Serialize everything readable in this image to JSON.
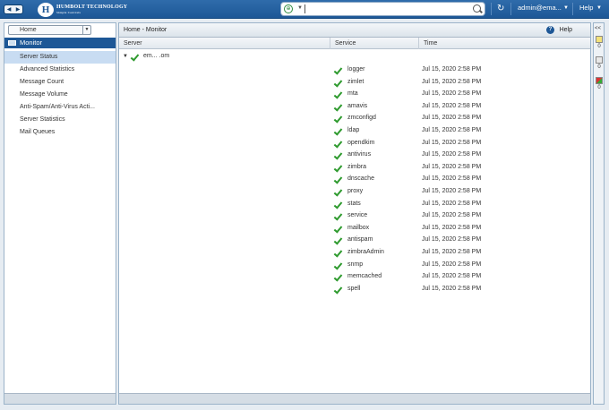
{
  "header": {
    "logo_text": "HUMBOLT TECHNOLOGY",
    "logo_subtext": "Simple Controls",
    "user": "admin@ema...",
    "help": "Help",
    "search": {
      "value": "",
      "placeholder": ""
    }
  },
  "left": {
    "home_select": "Home",
    "section": "Monitor",
    "items": [
      "Server Status",
      "Advanced Statistics",
      "Message Count",
      "Message Volume",
      "Anti-Spam/Anti-Virus Acti...",
      "Server Statistics",
      "Mail Queues"
    ],
    "selected_index": 0
  },
  "main": {
    "breadcrumb": "Home - Monitor",
    "help": "Help",
    "columns": {
      "server": "Server",
      "service": "Service",
      "time": "Time"
    },
    "server_name": "em...                    .om",
    "services": [
      {
        "name": "logger",
        "time": "Jul 15, 2020 2:58 PM"
      },
      {
        "name": "zimlet",
        "time": "Jul 15, 2020 2:58 PM"
      },
      {
        "name": "mta",
        "time": "Jul 15, 2020 2:58 PM"
      },
      {
        "name": "amavis",
        "time": "Jul 15, 2020 2:58 PM"
      },
      {
        "name": "zmconfigd",
        "time": "Jul 15, 2020 2:58 PM"
      },
      {
        "name": "ldap",
        "time": "Jul 15, 2020 2:58 PM"
      },
      {
        "name": "opendkim",
        "time": "Jul 15, 2020 2:58 PM"
      },
      {
        "name": "antivirus",
        "time": "Jul 15, 2020 2:58 PM"
      },
      {
        "name": "zimbra",
        "time": "Jul 15, 2020 2:58 PM"
      },
      {
        "name": "dnscache",
        "time": "Jul 15, 2020 2:58 PM"
      },
      {
        "name": "proxy",
        "time": "Jul 15, 2020 2:58 PM"
      },
      {
        "name": "stats",
        "time": "Jul 15, 2020 2:58 PM"
      },
      {
        "name": "service",
        "time": "Jul 15, 2020 2:58 PM"
      },
      {
        "name": "mailbox",
        "time": "Jul 15, 2020 2:58 PM"
      },
      {
        "name": "antispam",
        "time": "Jul 15, 2020 2:58 PM"
      },
      {
        "name": "zimbraAdmin",
        "time": "Jul 15, 2020 2:58 PM"
      },
      {
        "name": "snmp",
        "time": "Jul 15, 2020 2:58 PM"
      },
      {
        "name": "memcached",
        "time": "Jul 15, 2020 2:58 PM"
      },
      {
        "name": "spell",
        "time": "Jul 15, 2020 2:58 PM"
      }
    ]
  },
  "right_strip": {
    "top": "<<",
    "counts": [
      "0",
      "0",
      "0"
    ]
  },
  "colors": {
    "header": "#1d5796",
    "selected": "#c8dcf2",
    "ok": "#2e9a2e"
  },
  "icons": [
    "back-forward-icon",
    "logo-icon",
    "search-scope-icon",
    "search-icon",
    "refresh-icon",
    "help-icon",
    "check-icon",
    "expand-triangle-icon",
    "monitor-icon"
  ]
}
